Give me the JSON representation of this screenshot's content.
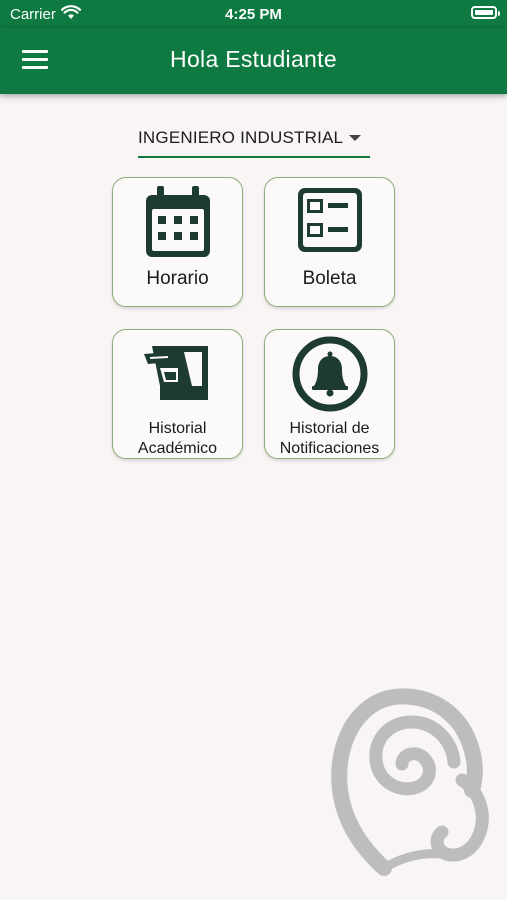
{
  "status_bar": {
    "carrier": "Carrier",
    "time": "4:25 PM"
  },
  "header": {
    "title": "Hola Estudiante"
  },
  "career_selector": {
    "value": "INGENIERO INDUSTRIAL"
  },
  "tiles": [
    {
      "line1": "Horario",
      "line2": ""
    },
    {
      "line1": "Boleta",
      "line2": ""
    },
    {
      "line1": "Historial",
      "line2": "Académico"
    },
    {
      "line1": "Historial de",
      "line2": "Notificaciones"
    }
  ],
  "colors": {
    "primary": "#0e7a41",
    "icon": "#1d3b30",
    "border": "#8aad78",
    "background": "#f8f5f4"
  }
}
